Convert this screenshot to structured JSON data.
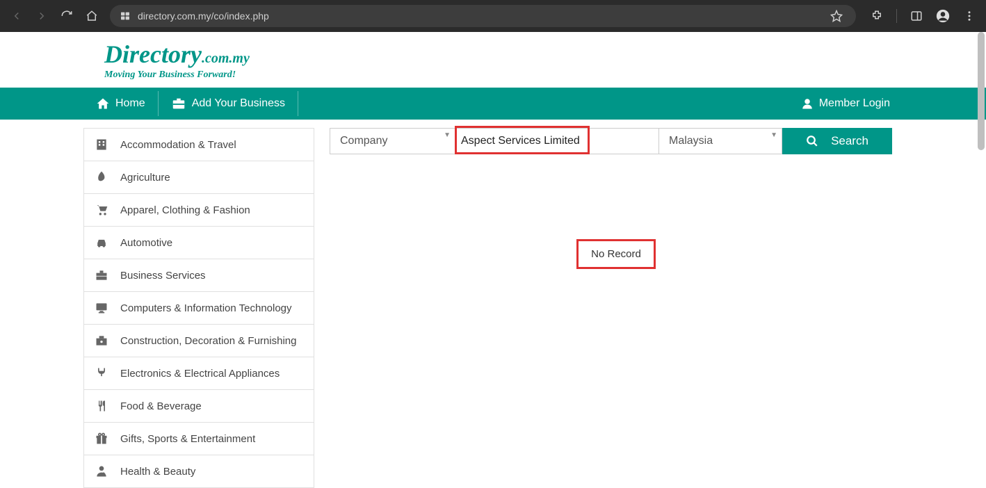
{
  "browser": {
    "url": "directory.com.my/co/index.php"
  },
  "logo": {
    "main": "Directory",
    "ext": ".com.my",
    "tagline": "Moving Your Business Forward!"
  },
  "nav": {
    "home": "Home",
    "add": "Add Your Business",
    "login": "Member Login"
  },
  "search": {
    "type_select": "Company",
    "query_value": "Aspect Services Limited",
    "country_select": "Malaysia",
    "button": "Search"
  },
  "result": {
    "message": "No Record"
  },
  "categories": [
    {
      "icon": "building",
      "label": "Accommodation & Travel"
    },
    {
      "icon": "leaf",
      "label": "Agriculture"
    },
    {
      "icon": "cart",
      "label": "Apparel, Clothing & Fashion"
    },
    {
      "icon": "car",
      "label": "Automotive"
    },
    {
      "icon": "briefcase",
      "label": "Business Services"
    },
    {
      "icon": "monitor",
      "label": "Computers & Information Technology"
    },
    {
      "icon": "tools",
      "label": "Construction, Decoration & Furnishing"
    },
    {
      "icon": "plug",
      "label": "Electronics & Electrical Appliances"
    },
    {
      "icon": "food",
      "label": "Food & Beverage"
    },
    {
      "icon": "gift",
      "label": "Gifts, Sports & Entertainment"
    },
    {
      "icon": "health",
      "label": "Health & Beauty"
    }
  ]
}
